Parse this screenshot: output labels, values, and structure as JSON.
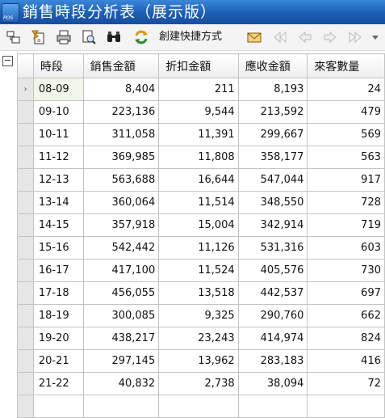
{
  "window": {
    "title": "銷售時段分析表（展示版）",
    "logo_text": "POS"
  },
  "toolbar": {
    "items": [
      {
        "name": "query-icon"
      },
      {
        "name": "export-icon"
      },
      {
        "name": "print-icon"
      },
      {
        "name": "preview-icon"
      },
      {
        "name": "find-icon"
      },
      {
        "name": "refresh-icon"
      },
      {
        "name": "create-shortcut-label",
        "label": "創建快捷方式"
      },
      {
        "name": "mail-icon"
      },
      {
        "name": "first-icon"
      },
      {
        "name": "prev-icon"
      },
      {
        "name": "next-icon"
      },
      {
        "name": "last-icon"
      },
      {
        "name": "more-icon"
      }
    ]
  },
  "table": {
    "columns": [
      "時段",
      "銷售金額",
      "折扣金額",
      "應收金額",
      "來客數量"
    ],
    "rows": [
      [
        "08-09",
        "8,404",
        "211",
        "8,193",
        "24"
      ],
      [
        "09-10",
        "223,136",
        "9,544",
        "213,592",
        "479"
      ],
      [
        "10-11",
        "311,058",
        "11,391",
        "299,667",
        "569"
      ],
      [
        "11-12",
        "369,985",
        "11,808",
        "358,177",
        "563"
      ],
      [
        "12-13",
        "563,688",
        "16,644",
        "547,044",
        "917"
      ],
      [
        "13-14",
        "360,064",
        "11,514",
        "348,550",
        "728"
      ],
      [
        "14-15",
        "357,918",
        "15,004",
        "342,914",
        "719"
      ],
      [
        "15-16",
        "542,442",
        "11,126",
        "531,316",
        "603"
      ],
      [
        "16-17",
        "417,100",
        "11,524",
        "405,576",
        "730"
      ],
      [
        "17-18",
        "456,055",
        "13,518",
        "442,537",
        "697"
      ],
      [
        "18-19",
        "300,085",
        "9,325",
        "290,760",
        "662"
      ],
      [
        "19-20",
        "438,217",
        "23,243",
        "414,974",
        "824"
      ],
      [
        "20-21",
        "297,145",
        "13,962",
        "283,183",
        "416"
      ],
      [
        "21-22",
        "40,832",
        "2,738",
        "38,094",
        "72"
      ],
      [
        "",
        "",
        "",
        "",
        ""
      ]
    ],
    "current_row_marker": "›",
    "group_toggle": "−"
  }
}
